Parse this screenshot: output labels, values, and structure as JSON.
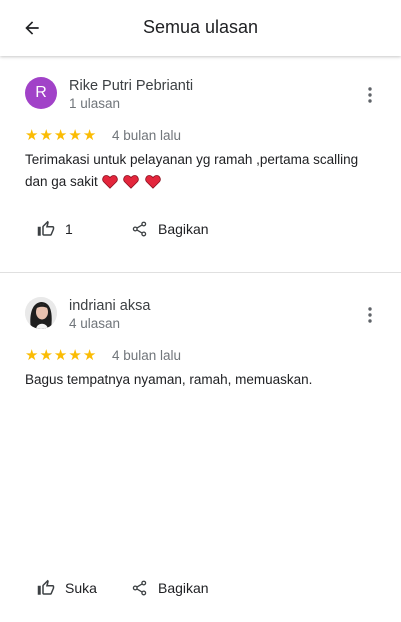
{
  "header": {
    "title": "Semua ulasan",
    "back_icon": "arrow-left-icon"
  },
  "reviews": [
    {
      "avatar_letter": "R",
      "avatar_color": "#a142c8",
      "name": "Rike Putri Pebrianti",
      "count": "1 ulasan",
      "rating": 5,
      "date": "4 bulan lalu",
      "text": "Terimakasi untuk pelayanan yg ramah ,pertama scalling dan ga sakit",
      "emoji": "heart x3",
      "likes": "1",
      "share_label": "Bagikan"
    },
    {
      "avatar": "photo",
      "name": "indriani aksa",
      "count": "4 ulasan",
      "rating": 5,
      "date": "4 bulan lalu",
      "text": "Bagus tempatnya nyaman, ramah, memuaskan.",
      "like_label": "Suka",
      "share_label": "Bagikan"
    }
  ],
  "colors": {
    "star": "#fbbc04",
    "secondary_text": "#70757a"
  }
}
